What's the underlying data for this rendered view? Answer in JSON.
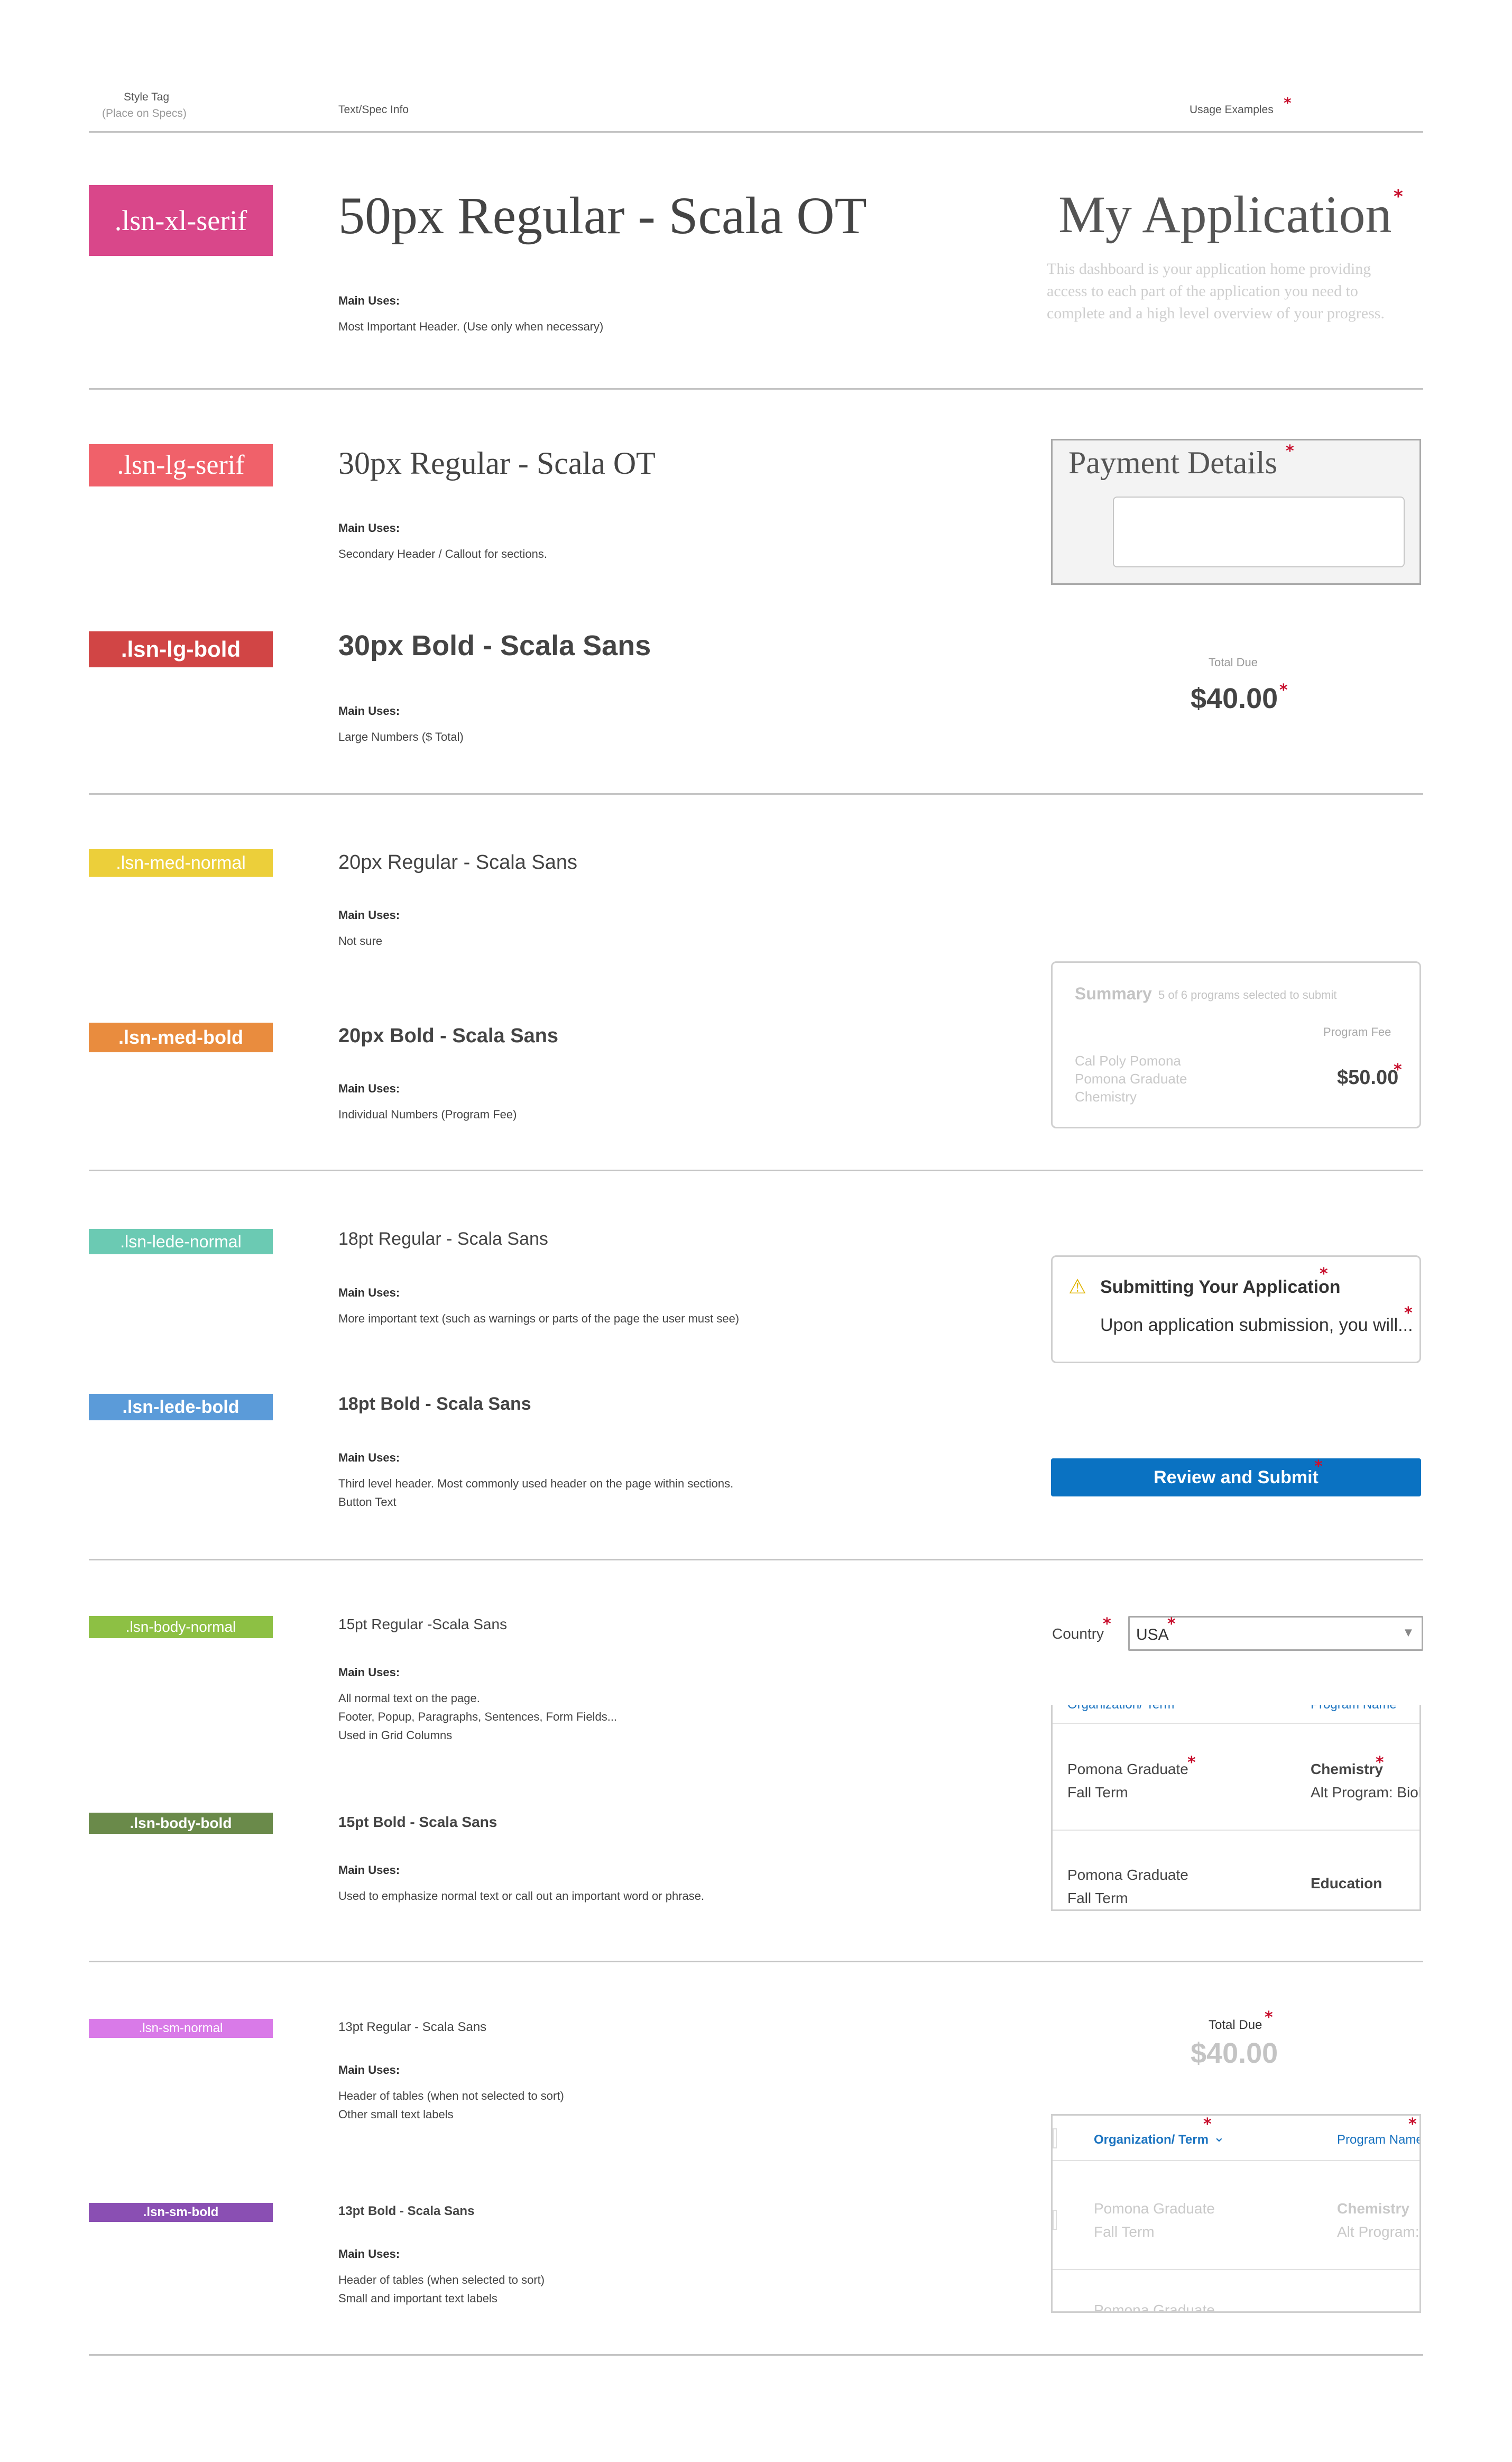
{
  "header": {
    "style_tag": "Style Tag",
    "style_tag_sub": "(Place on Specs)",
    "text_spec": "Text/Spec Info",
    "usage_examples": "Usage Examples",
    "star": "*"
  },
  "main_uses_label": "Main Uses:",
  "styles": {
    "xl_serif": {
      "tag": ".lsn-xl-serif",
      "spec": "50px Regular - Scala OT",
      "uses": [
        "Most Important Header. (Use only when necessary)"
      ],
      "color": "#d9478a"
    },
    "lg_serif": {
      "tag": ".lsn-lg-serif",
      "spec": "30px Regular - Scala OT",
      "uses": [
        "Secondary Header / Callout for sections."
      ],
      "color": "#f0616a"
    },
    "lg_bold": {
      "tag": ".lsn-lg-bold",
      "spec": "30px Bold - Scala Sans",
      "uses": [
        "Large Numbers ($ Total)"
      ],
      "color": "#d14545"
    },
    "med_normal": {
      "tag": ".lsn-med-normal",
      "spec": "20px Regular - Scala Sans",
      "uses": [
        "Not sure"
      ],
      "color": "#eccf3a"
    },
    "med_bold": {
      "tag": ".lsn-med-bold",
      "spec": "20px Bold - Scala Sans",
      "uses": [
        "Individual Numbers (Program Fee)"
      ],
      "color": "#e98c3e"
    },
    "lede_normal": {
      "tag": ".lsn-lede-normal",
      "spec": "18pt Regular - Scala Sans",
      "uses": [
        "More important text (such as warnings or parts of the page the user must see)"
      ],
      "color": "#6bcab3"
    },
    "lede_bold": {
      "tag": ".lsn-lede-bold",
      "spec": "18pt Bold - Scala Sans",
      "uses": [
        "Third level header. Most commonly used header on the page within sections.",
        "Button Text"
      ],
      "color": "#5b9bd9"
    },
    "body_normal": {
      "tag": ".lsn-body-normal",
      "spec": "15pt Regular -Scala Sans",
      "uses": [
        "All normal text on the page.",
        "Footer, Popup, Paragraphs, Sentences, Form Fields...",
        "Used in Grid Columns"
      ],
      "color": "#8dc044"
    },
    "body_bold": {
      "tag": ".lsn-body-bold",
      "spec": "15pt Bold - Scala Sans",
      "uses": [
        "Used to emphasize normal text or call out an important word or phrase."
      ],
      "color": "#6a8a4a"
    },
    "sm_normal": {
      "tag": ".lsn-sm-normal",
      "spec": "13pt Regular - Scala Sans",
      "uses": [
        "Header of tables (when not selected to sort)",
        "Other small text labels"
      ],
      "color": "#d97ae8"
    },
    "sm_bold": {
      "tag": ".lsn-sm-bold",
      "spec": "13pt Bold - Scala Sans",
      "uses": [
        "Header of tables (when selected to sort)",
        "Small and important text labels"
      ],
      "color": "#8a4fb3"
    }
  },
  "examples": {
    "my_app": {
      "title": "My Application",
      "desc": [
        "This dashboard is your application home providing",
        "access to each part of the application you need to",
        "complete and a high level overview of your progress."
      ]
    },
    "payment": {
      "title": "Payment Details"
    },
    "total_due": {
      "label": "Total Due",
      "amount": "$40.00"
    },
    "summary": {
      "title": "Summary",
      "subtitle": "5 of 6 programs selected to submit",
      "fee_label": "Program Fee",
      "lines": [
        "Cal Poly Pomona",
        "Pomona Graduate",
        "Chemistry"
      ],
      "fee": "$50.00"
    },
    "submitting": {
      "title": "Submitting Your Application",
      "body": "Upon application submission, you will..."
    },
    "button": {
      "label": "Review and Submit",
      "color": "#0a72c2"
    },
    "country": {
      "label": "Country",
      "value": "USA"
    },
    "grid1": {
      "header_cut_left": "Organization/ Term",
      "header_cut_right": "Program Name",
      "rows": [
        {
          "org": "Pomona Graduate",
          "term": "Fall Term",
          "program": "Chemistry",
          "sub": "Alt Program: Biol"
        },
        {
          "org": "Pomona Graduate",
          "term": "Fall Term",
          "program": "Education",
          "sub": ""
        }
      ]
    },
    "total_due_2": {
      "label": "Total Due",
      "amount": "$40.00"
    },
    "grid2": {
      "col1": "Organization/ Term",
      "col2": "Program Name",
      "rows": [
        {
          "org": "Pomona Graduate",
          "term": "Fall Term",
          "program": "Chemistry",
          "sub": "Alt Program:"
        },
        {
          "org": "Pomona Graduate",
          "term": "",
          "program": "",
          "sub": ""
        }
      ]
    }
  }
}
